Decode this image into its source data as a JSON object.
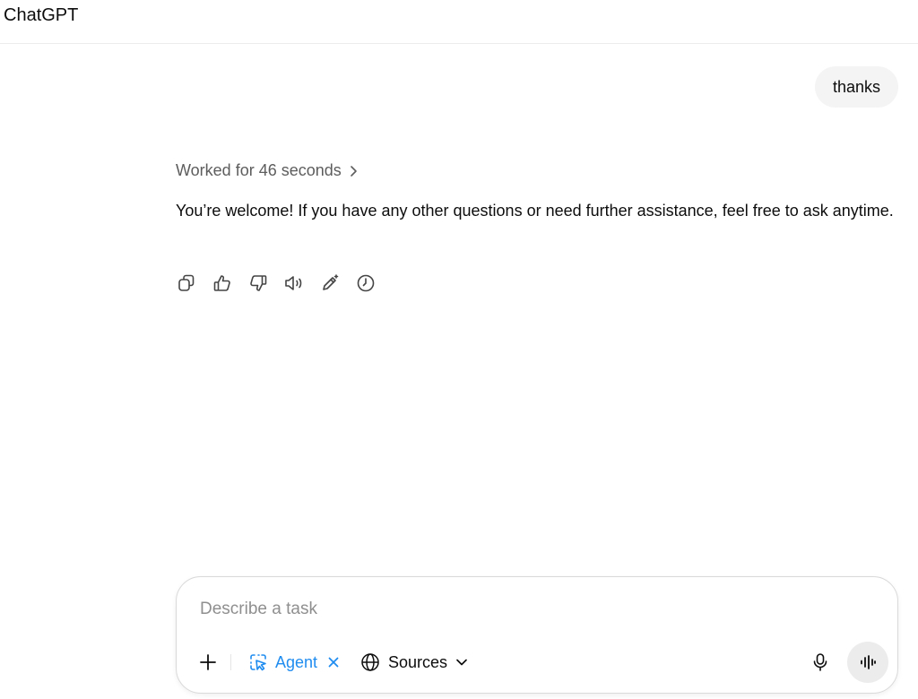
{
  "app": {
    "title": "ChatGPT"
  },
  "conversation": {
    "user_message": "thanks",
    "assistant": {
      "worked_for": "Worked for 46 seconds",
      "reply": "You’re welcome! If you have any other questions or need further assistance, feel free to ask anytime.",
      "actions": [
        {
          "icon": "copy-icon"
        },
        {
          "icon": "thumbs-up-icon"
        },
        {
          "icon": "thumbs-down-icon"
        },
        {
          "icon": "read-aloud-icon"
        },
        {
          "icon": "edit-in-canvas-icon"
        },
        {
          "icon": "clock-icon"
        }
      ]
    }
  },
  "composer": {
    "placeholder": "Describe a task",
    "value": "",
    "agent_label": "Agent",
    "sources_label": "Sources",
    "accent_color": "#1f8cf0"
  }
}
